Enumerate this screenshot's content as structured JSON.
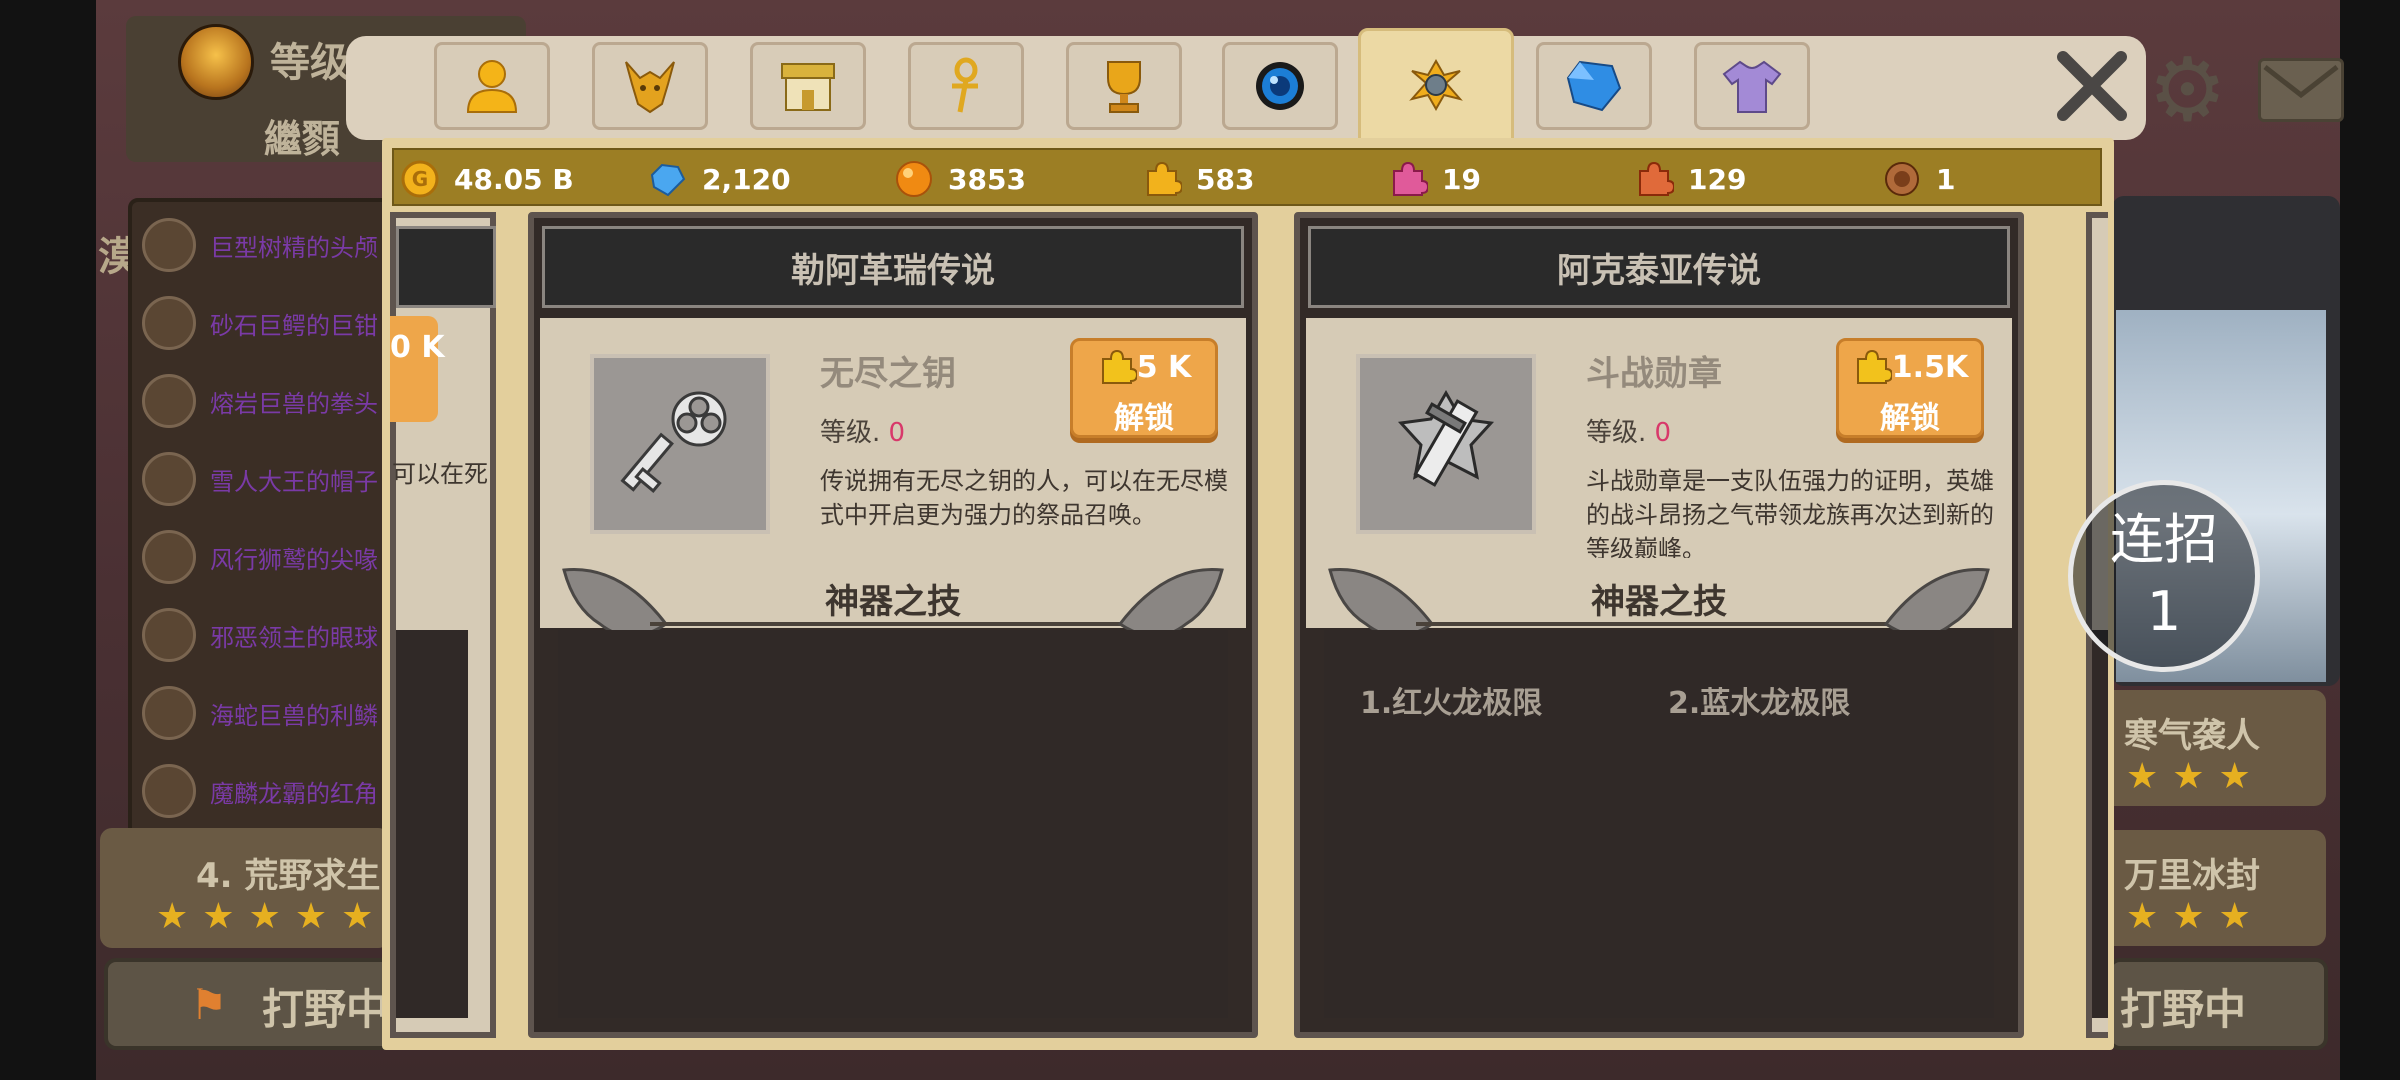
{
  "background": {
    "header": {
      "level_label": "等级",
      "sub_label": "繼顟"
    },
    "side_label": "漠",
    "list_items": [
      "巨型树精的头颅",
      "砂石巨鳄的巨钳",
      "熔岩巨兽的拳头",
      "雪人大王的帽子",
      "风行狮鹫的尖喙",
      "邪恶领主的眼球",
      "海蛇巨兽的利鳞",
      "魔麟龙霸的红角"
    ],
    "stage_left": {
      "title": "4. 荒野求生",
      "stars": "★★★★★"
    },
    "stage_right_1": {
      "title": "寒气袭人",
      "stars": "★★★"
    },
    "stage_right_2": {
      "title": "万里冰封",
      "stars": "★★★"
    },
    "button_left": "打野中",
    "button_right": "打野中",
    "icons": [
      "hero-avatar-icon",
      "flag-icon",
      "gear-icon",
      "mail-icon"
    ]
  },
  "combo": {
    "label": "连招",
    "count": "1"
  },
  "tabs": [
    {
      "name": "hero",
      "icon": "person-icon",
      "active": false
    },
    {
      "name": "dragon",
      "icon": "dragon-head-icon",
      "active": false
    },
    {
      "name": "shop",
      "icon": "shop-icon",
      "active": false
    },
    {
      "name": "key",
      "icon": "ankh-key-icon",
      "active": false
    },
    {
      "name": "trophy",
      "icon": "trophy-icon",
      "active": false
    },
    {
      "name": "orb",
      "icon": "blue-orb-icon",
      "active": false
    },
    {
      "name": "artifact",
      "icon": "artifact-icon",
      "active": true
    },
    {
      "name": "gem",
      "icon": "blue-gem-icon",
      "active": false
    },
    {
      "name": "outfit",
      "icon": "shirt-icon",
      "active": false
    }
  ],
  "currencies": [
    {
      "name": "gold",
      "icon": "gold-coin-icon",
      "value": "48.05 B"
    },
    {
      "name": "diamond",
      "icon": "diamond-icon",
      "value": "2,120"
    },
    {
      "name": "orb",
      "icon": "orange-orb-icon",
      "value": "3853"
    },
    {
      "name": "puzzle_gold",
      "icon": "gold-puzzle-icon",
      "value": "583"
    },
    {
      "name": "puzzle_pink",
      "icon": "pink-puzzle-icon",
      "value": "19"
    },
    {
      "name": "puzzle_red",
      "icon": "red-puzzle-icon",
      "value": "129"
    },
    {
      "name": "token",
      "icon": "bronze-token-icon",
      "value": "1"
    }
  ],
  "side_left": {
    "cost_fragment": "0 K",
    "desc_fragment": "可以在死"
  },
  "panels": [
    {
      "title": "勒阿革瑞传说",
      "item_name": "无尽之钥",
      "item_icon": "endless-key-icon",
      "level_label": "等级.",
      "level_value": "0",
      "description": "传说拥有无尽之钥的人，可以在无尽模式中开启更为强力的祭品召唤。",
      "unlock_cost": "5 K",
      "unlock_label": "解锁",
      "skills_title": "神器之技",
      "skills": []
    },
    {
      "title": "阿克泰亚传说",
      "item_name": "斗战勋章",
      "item_icon": "battle-medal-icon",
      "level_label": "等级.",
      "level_value": "0",
      "description": "斗战勋章是一支队伍强力的证明，英雄的战斗昂扬之气带领龙族再次达到新的等级巅峰。",
      "unlock_cost": "1.5K",
      "unlock_label": "解锁",
      "skills_title": "神器之技",
      "skills": [
        "1.红火龙极限",
        "2.蓝水龙极限"
      ]
    }
  ],
  "colors": {
    "dialog_bg": "#e3cf9c",
    "currency_bar": "#9c7e24",
    "panel_dark": "#302927",
    "unlock_btn": "#eea64a",
    "level_value": "#d8386a"
  }
}
